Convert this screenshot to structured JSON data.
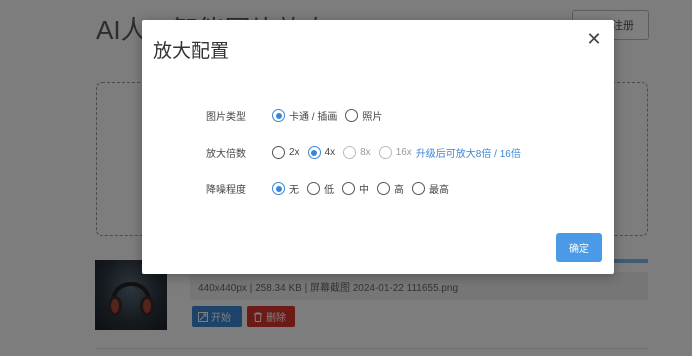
{
  "background": {
    "title": "AI人工智能图片放大",
    "login_button": "登录/注册",
    "file_info": "440x440px | 258.34 KB | 屏幕截图 2024-01-22 111655.png",
    "start_button": "开始",
    "delete_button": "删除"
  },
  "modal": {
    "title": "放大配置",
    "close_symbol": "✕",
    "confirm_label": "确定",
    "rows": {
      "image_type": {
        "label": "图片类型",
        "options": [
          "卡通 / 插画",
          "照片"
        ],
        "selected": "卡通 / 插画"
      },
      "scale": {
        "label": "放大倍数",
        "options": [
          "2x",
          "4x",
          "8x",
          "16x"
        ],
        "selected": "4x",
        "disabled": [
          "8x",
          "16x"
        ],
        "upgrade_link": "升级后可放大8倍 / 16倍"
      },
      "denoise": {
        "label": "降噪程度",
        "options": [
          "无",
          "低",
          "中",
          "高",
          "最高"
        ],
        "selected": "无"
      }
    }
  },
  "colors": {
    "accent": "#3a86d4",
    "confirm": "#4a9ae8",
    "delete": "#d9342b"
  }
}
